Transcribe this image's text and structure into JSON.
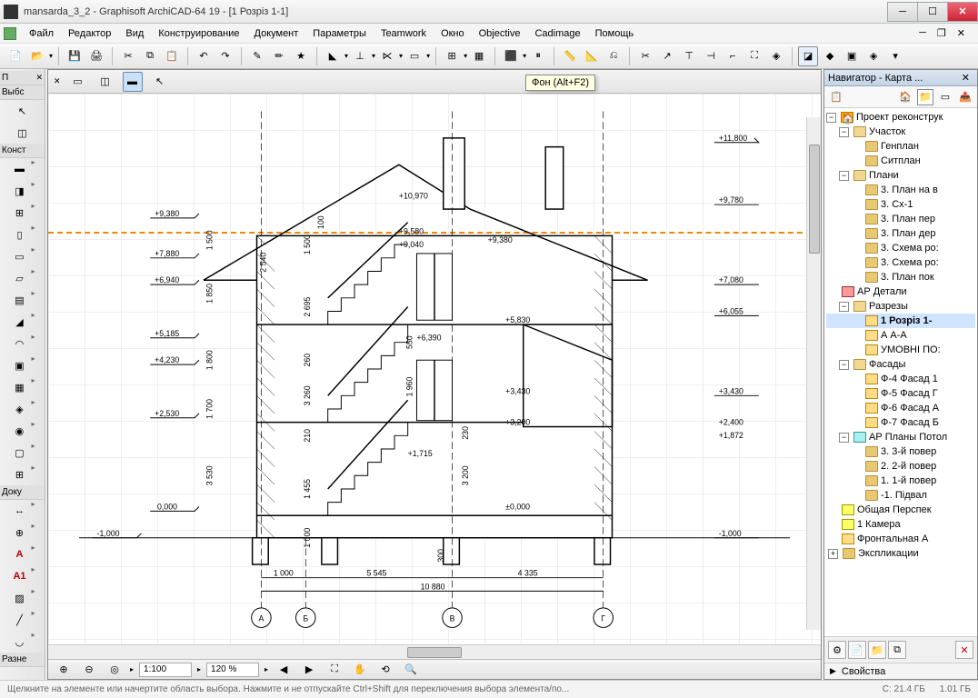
{
  "window": {
    "title": "mansarda_3_2 - Graphisoft ArchiCAD-64 19 - [1 Розріз 1-1]"
  },
  "menu": [
    "Файл",
    "Редактор",
    "Вид",
    "Конструирование",
    "Документ",
    "Параметры",
    "Teamwork",
    "Окно",
    "Objective",
    "Cadimage",
    "Помощь"
  ],
  "tooltip": "Фон (Alt+F2)",
  "toolbox": {
    "header1": "П",
    "header2": "Выбс",
    "header3": "Конст",
    "header4": "Доку",
    "header5": "Разне"
  },
  "zoom": {
    "scale": "1:100",
    "percent": "120 %"
  },
  "navigator": {
    "title": "Навигатор - Карта ...",
    "project": "Проект реконструк",
    "tree": {
      "n1": "Участок",
      "n1a": "Генплан",
      "n1b": "Ситплан",
      "n2": "Плани",
      "n2a": "3. План на в",
      "n2b": "3. Сх-1",
      "n2c": "3. План пер",
      "n2d": "3. План дер",
      "n2e": "3. Схема ро:",
      "n2f": "3. Схема ро:",
      "n2g": "3. План пок",
      "n3": "АР Детали",
      "n4": "Разрезы",
      "n4a": "1 Розріз 1-",
      "n4b": "А А-А",
      "n4c": "УМОВНІ ПО:",
      "n5": "Фасады",
      "n5a": "Ф-4 Фасад 1",
      "n5b": "Ф-5 Фасад Г",
      "n5c": "Ф-6 Фасад А",
      "n5d": "Ф-7 Фасад Б",
      "n6": "АР Планы Потол",
      "n6a": "3. 3-й повер",
      "n6b": "2. 2-й повер",
      "n6c": "1. 1-й повер",
      "n6d": "-1. Підвал",
      "n7": "Общая Перспек",
      "n8": "1 Камера",
      "n9": "Фронтальная А",
      "n10": "Экспликации"
    },
    "props": "Свойства"
  },
  "status": {
    "hint": "Щелкните на элементе или начертите область выбора. Нажмите и не отпускайте Ctrl+Shift для переключения выбора элемента/по...",
    "mem1": "C: 21.4 ГБ",
    "mem2": "1.01 ГБ"
  },
  "chart_data": {
    "type": "section_drawing",
    "title": "Розріз 1-1",
    "axes": [
      "А",
      "Б",
      "В",
      "Г"
    ],
    "axis_spacing_m": {
      "А-Б": 1.0,
      "Б-В": 5.545,
      "В-Г": 4.335,
      "total": 10.88
    },
    "elevations_left_m": [
      9.38,
      7.88,
      6.94,
      5.185,
      4.23,
      2.53,
      0.0,
      -1.0
    ],
    "elevations_right_m": [
      11.8,
      9.78,
      9.38,
      7.08,
      6.055,
      5.83,
      3.43,
      3.2,
      2.4,
      1.872,
      0.0,
      -1.0
    ],
    "elevations_center_m": [
      10.97,
      9.58,
      9.04,
      6.39,
      3.43,
      1.715
    ],
    "vertical_dims_mm": [
      1500,
      1850,
      1800,
      1700,
      3530,
      100,
      2540,
      2695,
      260,
      1960,
      550,
      210,
      3260,
      1455,
      230,
      3200,
      1000,
      300
    ],
    "ylim_m": [
      -1.0,
      11.8
    ]
  }
}
